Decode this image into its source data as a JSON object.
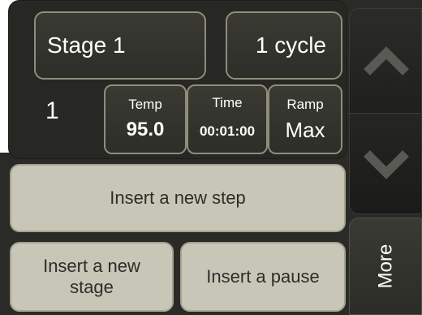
{
  "stage": {
    "name": "Stage 1",
    "cycles": "1 cycle"
  },
  "step": {
    "number": "1",
    "temp_label": "Temp",
    "temp_value": "95.0",
    "time_label": "Time",
    "time_value": "00:01:00",
    "ramp_label": "Ramp",
    "ramp_value": "Max"
  },
  "actions": {
    "insert_step": "Insert a new step",
    "insert_stage": "Insert a new stage",
    "insert_pause": "Insert a pause"
  },
  "nav": {
    "up_icon": "chevron-up-icon",
    "down_icon": "chevron-down-icon",
    "more_label": "More"
  },
  "colors": {
    "panel": "#272723",
    "button_outline": "#8f8d7a",
    "beige_button": "#c8c6b6",
    "chevron": "#5a5a55"
  }
}
